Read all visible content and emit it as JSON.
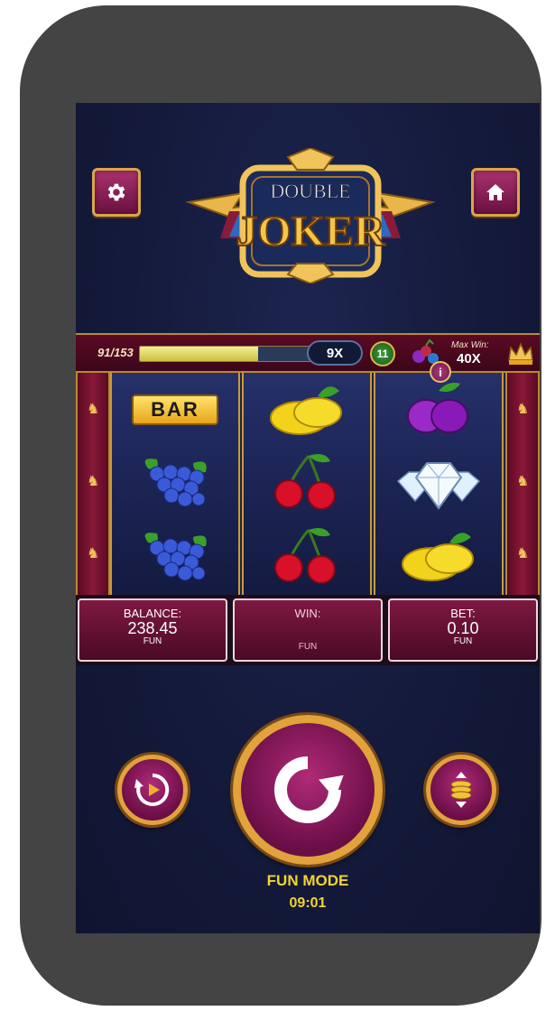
{
  "game": {
    "logo_top": "DOUBLE",
    "logo_main": "JOKER"
  },
  "toolbar": {
    "settings_icon": "gear-icon",
    "home_icon": "home-icon"
  },
  "meter": {
    "count": "91/153",
    "progress_fraction": 0.595,
    "multiplier": "9X",
    "spins_left": "11",
    "max_win_label": "Max Win:",
    "max_win_value": "40X",
    "info_label": "i"
  },
  "reels": [
    [
      "bar",
      "grapes",
      "grapes"
    ],
    [
      "lemon",
      "cherries",
      "cherries"
    ],
    [
      "plum",
      "diamond",
      "lemon"
    ]
  ],
  "symbols": {
    "bar_label": "BAR"
  },
  "panels": {
    "balance": {
      "label": "BALANCE:",
      "value": "238.45",
      "unit": "FUN"
    },
    "win": {
      "label": "WIN:",
      "value": "",
      "unit": "FUN"
    },
    "bet": {
      "label": "BET:",
      "value": "0.10",
      "unit": "FUN"
    }
  },
  "status": {
    "mode": "FUN MODE",
    "clock": "09:01"
  },
  "colors": {
    "accent_gold": "#e2a23c",
    "button_purple": "#8a1a5a",
    "status_yellow": "#f2d42e",
    "background_navy": "#141a3a"
  }
}
